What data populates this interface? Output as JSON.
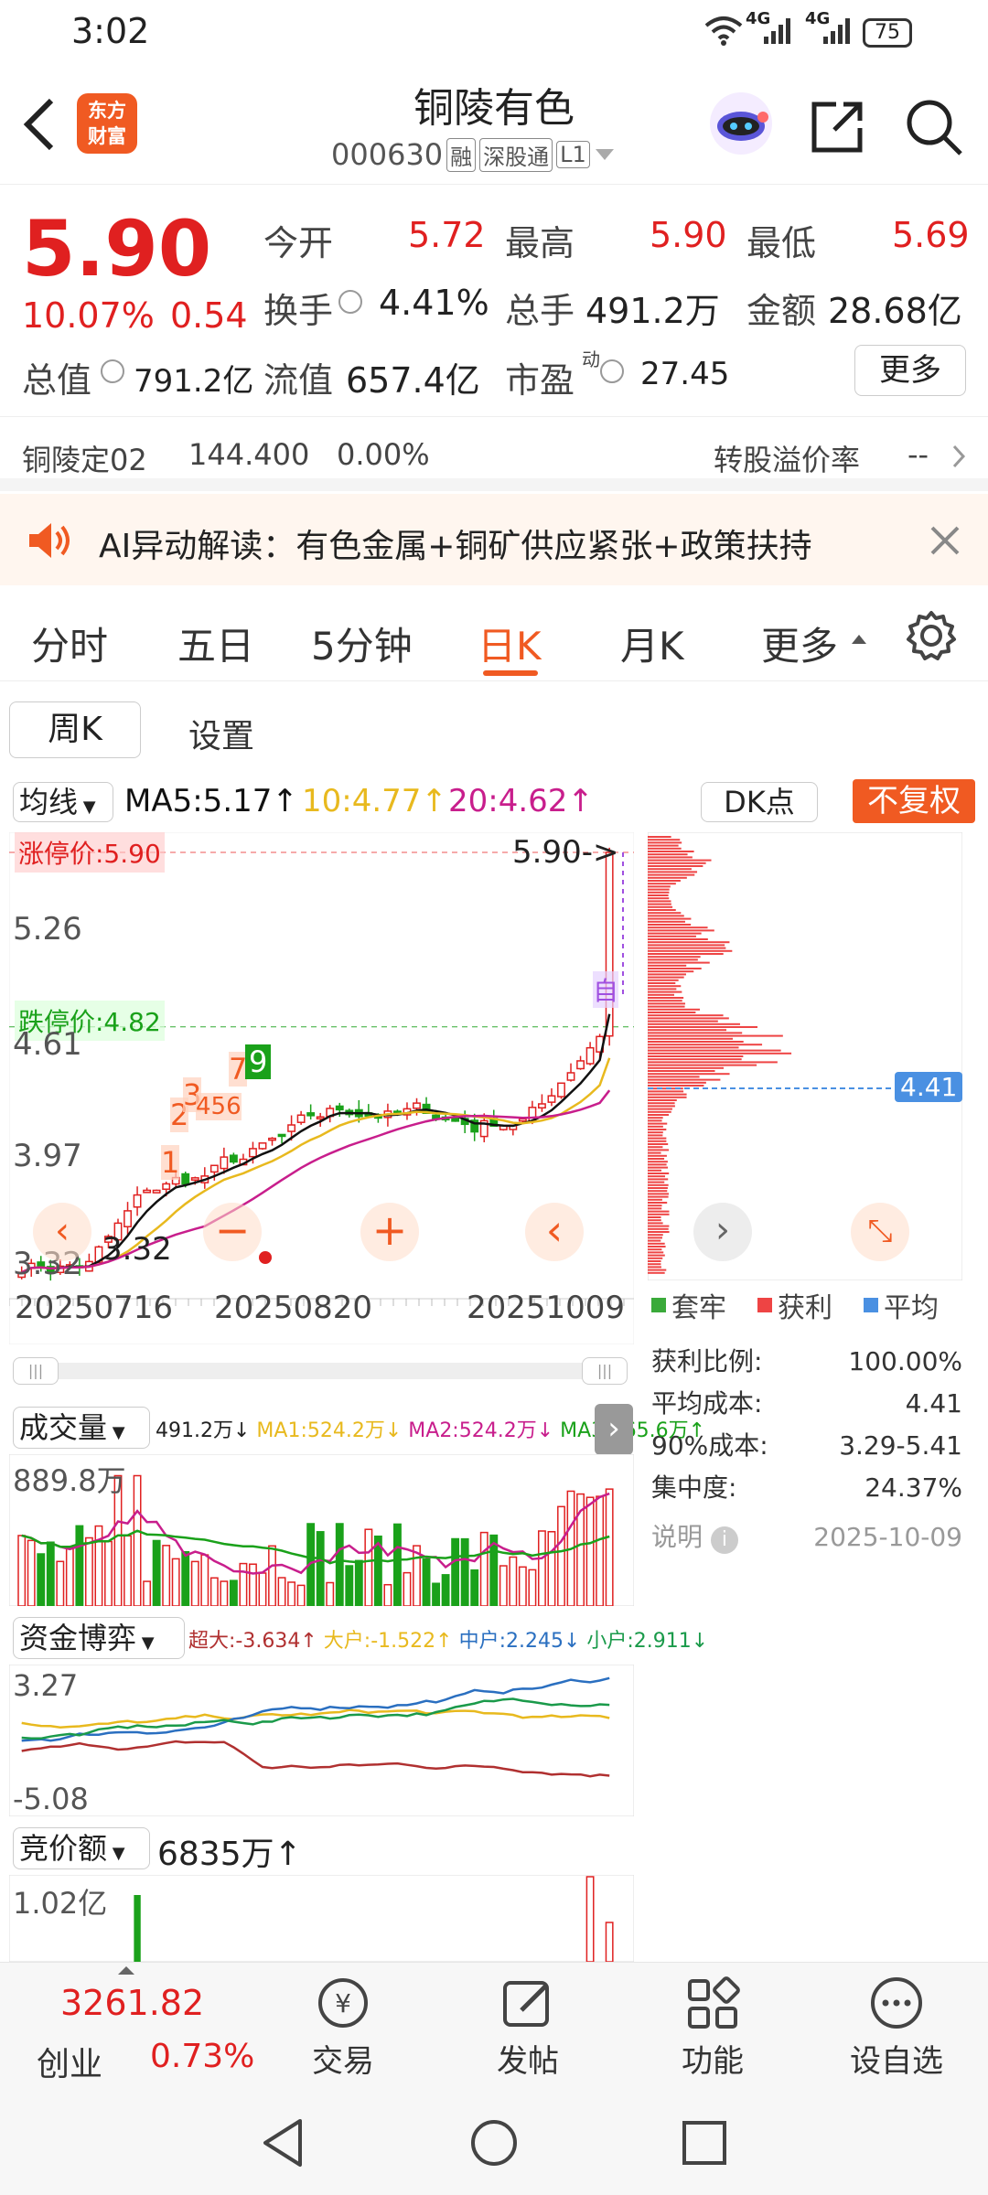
{
  "status": {
    "time": "3:02",
    "net1": "4G",
    "net2": "4G",
    "battery": "75"
  },
  "header": {
    "logo_line1": "东方",
    "logo_line2": "财富",
    "stock_name": "铜陵有色",
    "stock_code": "000630",
    "tag_margin": "融",
    "tag_connect": "深股通",
    "tag_level": "L1"
  },
  "quote": {
    "price": "5.90",
    "change_pct": "10.07%",
    "change_amt": "0.54",
    "open_label": "今开",
    "open": "5.72",
    "high_label": "最高",
    "high": "5.90",
    "low_label": "最低",
    "low": "5.69",
    "turnover_label": "换手",
    "turnover": "4.41%",
    "volume_label": "总手",
    "volume": "491.2万",
    "amount_label": "金额",
    "amount": "28.68亿",
    "mktcap_label": "总值",
    "mktcap": "791.2亿",
    "float_label": "流值",
    "float": "657.4亿",
    "pe_label": "市盈",
    "pe_sup": "动",
    "pe": "27.45",
    "more_btn": "更多"
  },
  "convertible": {
    "name": "铜陵定02",
    "price": "144.400",
    "pct": "0.00%",
    "premium_label": "转股溢价率",
    "premium": "--"
  },
  "ai": {
    "text": "AI异动解读：有色金属+铜矿供应紧张+政策扶持"
  },
  "tabs": [
    "分时",
    "五日",
    "5分钟",
    "日K",
    "月K",
    "更多"
  ],
  "subtabs": {
    "weekly": "周K",
    "settings": "设置"
  },
  "kline": {
    "ma_selector": "均线",
    "ma5": "MA5:5.17↑",
    "ma10": "10:4.77↑",
    "ma20": "20:4.62↑",
    "dk_btn": "DK点",
    "adjust_btn": "不复权",
    "limit_up": "涨停价:5.90",
    "limit_down": "跌停价:4.82",
    "y_labels": [
      "5.26",
      "4.61",
      "3.97",
      "3.32"
    ],
    "low_mark": "3.32",
    "high_mark": "5.90->",
    "x_labels": [
      "20250716",
      "20250820",
      "20251009"
    ],
    "seq_labels": [
      "1",
      "2",
      "3",
      "456",
      "7",
      "9"
    ],
    "self_marker": "自"
  },
  "chips": {
    "avg_badge": "4.41",
    "legend_locked": "套牢",
    "legend_profit": "获利",
    "legend_avg": "平均",
    "profit_ratio_label": "获利比例:",
    "profit_ratio": "100.00%",
    "avg_cost_label": "平均成本:",
    "avg_cost": "4.41",
    "cost90_label": "90%成本:",
    "cost90": "3.29-5.41",
    "concentration_label": "集中度:",
    "concentration": "24.37%",
    "note_label": "说明",
    "date": "2025-10-09"
  },
  "volume": {
    "selector": "成交量",
    "val": "491.2万↓",
    "ma1": "MA1:524.2万↓",
    "ma2": "MA2:524.2万↓",
    "ma3": "MA3:365.6万↑",
    "y_max": "889.8万"
  },
  "fund": {
    "selector": "资金博弈",
    "super": "超大:-3.634↑",
    "big": "大户:-1.522↑",
    "mid": "中户:2.245↓",
    "small": "小户:2.911↓",
    "y_max": "3.27",
    "y_min": "-5.08"
  },
  "auction": {
    "selector": "竞价额",
    "value": "6835万↑",
    "y_max": "1.02亿"
  },
  "bottomnav": {
    "index_value": "3261.82",
    "index_name": "创业",
    "index_pct": "0.73%",
    "trade": "交易",
    "post": "发帖",
    "func": "功能",
    "watch": "设自选"
  },
  "colors": {
    "up": "#e02020",
    "down": "#1aa11a",
    "accent": "#f05a22",
    "ma5": "#111111",
    "ma10": "#e8b91e",
    "ma20": "#c81e8c"
  }
}
